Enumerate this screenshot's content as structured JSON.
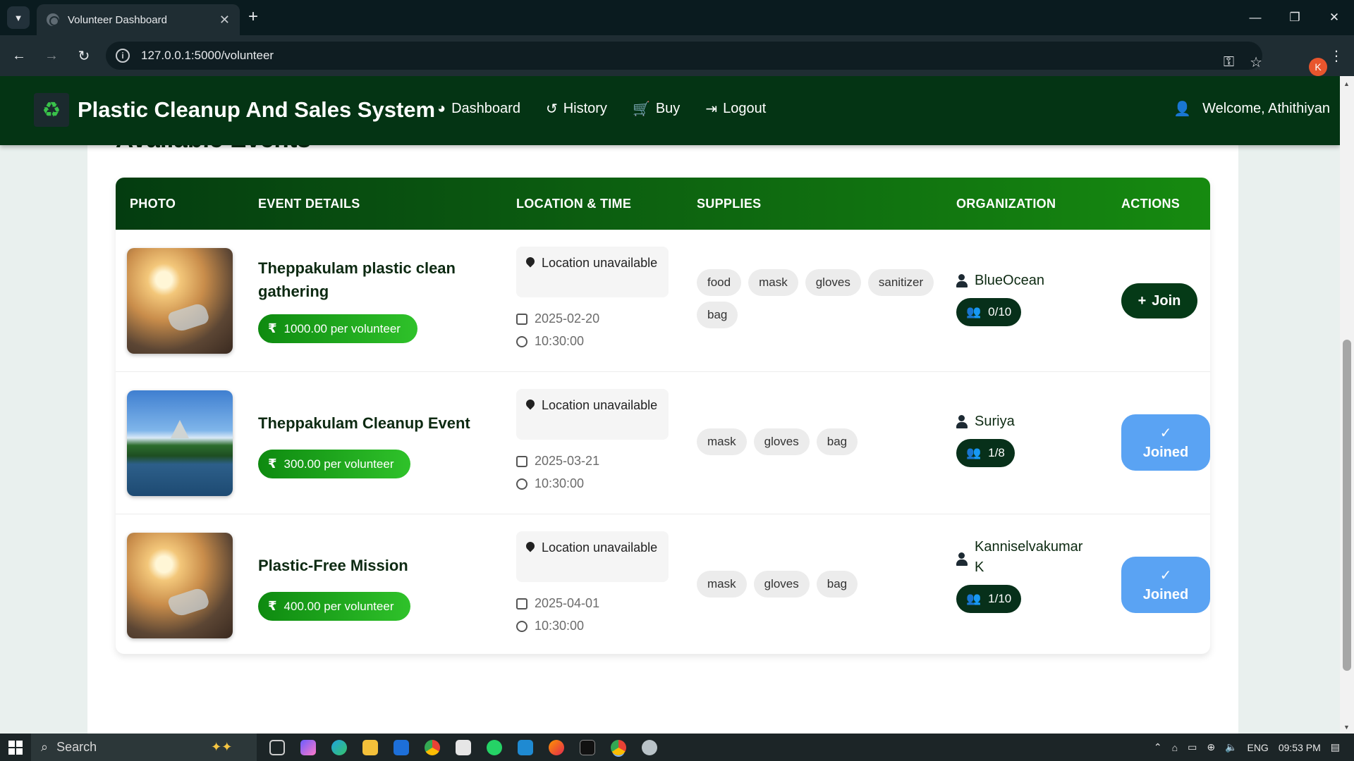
{
  "browser": {
    "tab_title": "Volunteer Dashboard",
    "url": "127.0.0.1:5000/volunteer",
    "profile_initial": "K"
  },
  "navbar": {
    "brand": "Plastic Cleanup And Sales System",
    "links": [
      {
        "label": "Dashboard",
        "icon": "dashboard-gauge-icon"
      },
      {
        "label": "History",
        "icon": "history-icon"
      },
      {
        "label": "Buy",
        "icon": "cart-icon"
      },
      {
        "label": "Logout",
        "icon": "logout-icon"
      }
    ],
    "welcome": "Welcome, Athithiyan"
  },
  "section_title": "Available Events",
  "table": {
    "headers": [
      "PHOTO",
      "EVENT DETAILS",
      "LOCATION & TIME",
      "SUPPLIES",
      "ORGANIZATION",
      "ACTIONS"
    ],
    "rows": [
      {
        "title": "Theppakulam plastic clean gathering",
        "price": "1000.00 per volunteer",
        "location": "Location unavailable",
        "date": "2025-02-20",
        "time": "10:30:00",
        "supplies": [
          "food",
          "mask",
          "gloves",
          "sanitizer",
          "bag"
        ],
        "organization": "BlueOcean",
        "volunteers": "0/10",
        "action": "Join"
      },
      {
        "title": "Theppakulam Cleanup Event",
        "price": "300.00 per volunteer",
        "location": "Location unavailable",
        "date": "2025-03-21",
        "time": "10:30:00",
        "supplies": [
          "mask",
          "gloves",
          "bag"
        ],
        "organization": "Suriya",
        "volunteers": "1/8",
        "action": "Joined"
      },
      {
        "title": "Plastic-Free Mission",
        "price": "400.00 per volunteer",
        "location": "Location unavailable",
        "date": "2025-04-01",
        "time": "10:30:00",
        "supplies": [
          "mask",
          "gloves",
          "bag"
        ],
        "organization": "Kanniselvakumar K",
        "volunteers": "1/10",
        "action": "Joined"
      }
    ],
    "currency_symbol": "₹"
  },
  "taskbar": {
    "search_placeholder": "Search",
    "language": "ENG",
    "clock": "09:53 PM"
  },
  "colors": {
    "navbar": "#043414",
    "header_gradient_start": "#043c10",
    "header_gradient_end": "#168a10",
    "price_green": "#1aa51a",
    "join_button": "#053a17",
    "joined_button": "#5aa3f3"
  }
}
